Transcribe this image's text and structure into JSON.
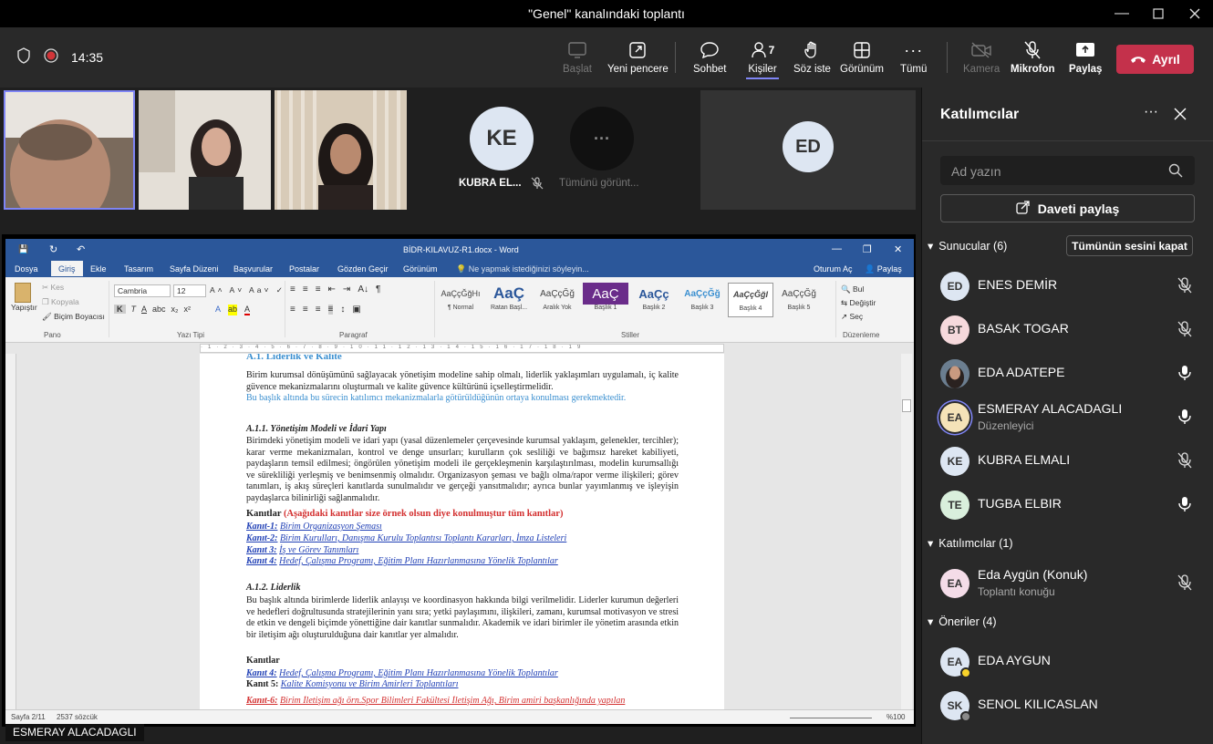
{
  "window": {
    "title": "\"Genel\" kanalındaki toplantı"
  },
  "toolbar": {
    "timer": "14:35",
    "start_label": "Başlat",
    "new_window_label": "Yeni pencere",
    "chat_label": "Sohbet",
    "people_label": "Kişiler",
    "people_count": "7",
    "raise_hand_label": "Söz iste",
    "view_label": "Görünüm",
    "more_label": "Tümü",
    "camera_label": "Kamera",
    "mic_label": "Mikrofon",
    "share_label": "Paylaş",
    "leave_label": "Ayrıl"
  },
  "stage": {
    "tile_ke_initials": "KE",
    "tile_ke_name": "KUBRA EL...",
    "view_all_label": "Tümünü görünt...",
    "tile_ed_initials": "ED",
    "presenter_name": "ESMERAY ALACADAGLI"
  },
  "word": {
    "doc_title": "BİDR-KILAVUZ-R1.docx - Word",
    "tabs": [
      "Dosya",
      "Giriş",
      "Ekle",
      "Tasarım",
      "Sayfa Düzeni",
      "Başvurular",
      "Postalar",
      "Gözden Geçir",
      "Görünüm"
    ],
    "tell_me": "Ne yapmak istediğinizi söyleyin...",
    "signin": "Oturum Aç",
    "share": "Paylaş",
    "clipboard": {
      "paste": "Yapıştır",
      "cut": "Kes",
      "copy": "Kopyala",
      "format_painter": "Biçim Boyacısı",
      "group": "Pano"
    },
    "font": {
      "name": "Cambria",
      "size": "12",
      "group": "Yazı Tipi"
    },
    "paragraph_group": "Paragraf",
    "styles": [
      {
        "preview": "AaÇçĞğHı",
        "name": "¶ Normal"
      },
      {
        "preview": "AaÇ",
        "name": "Ratan Başl..."
      },
      {
        "preview": "AaÇçĞğ",
        "name": "Aralık Yok"
      },
      {
        "preview": "AaÇ",
        "name": "Başlık 1"
      },
      {
        "preview": "AaÇç",
        "name": "Başlık 2"
      },
      {
        "preview": "AaÇçĞğ",
        "name": "Başlık 3"
      },
      {
        "preview": "AaÇçĞğI",
        "name": "Başlık 4"
      },
      {
        "preview": "AaÇçĞğ",
        "name": "Başlık 5"
      }
    ],
    "styles_group": "Stiller",
    "editing": {
      "find": "Bul",
      "replace": "Değiştir",
      "select": "Seç",
      "group": "Düzenleme"
    },
    "status_page": "Sayfa 2/11",
    "status_words": "2537 sözcük",
    "zoom": "%100",
    "doc": {
      "heading_partial": "A.1. Liderlik ve Kalite",
      "intro": "Birim kurumsal dönüşümünü sağlayacak yönetişim modeline sahip olmalı, liderlik yaklaşımları uygulamalı, iç kalite güvence mekanizmalarını oluşturmalı ve kalite güvence kültürünü içselleştirmelidir.",
      "intro_blue": "Bu başlık altında bu sürecin katılımcı mekanizmalarla götürüldüğünün ortaya konulması gerekmektedir.",
      "h_a11": "A.1.1. Yönetişim Modeli ve İdari Yapı",
      "a11_text": "Birimdeki yönetişim modeli ve idari yapı (yasal düzenlemeler çerçevesinde kurumsal yaklaşım, gelenekler, tercihler); karar verme mekanizmaları, kontrol ve denge unsurları; kurulların çok sesliliği ve bağımsız hareket kabiliyeti, paydaşların temsil edilmesi; öngörülen yönetişim modeli ile gerçekleşmenin karşılaştırılması, modelin kurumsallığı ve sürekliliği yerleşmiş ve benimsenmiş olmalıdır. Organizasyon şeması ve bağlı olma/rapor verme ilişkileri; görev tanımları, iş akış süreçleri kanıtlarda sunulmalıdır ve gerçeği yansıtmalıdır; ayrıca bunlar yayımlanmış ve işleyişin paydaşlarca bilinirliği sağlanmalıdır.",
      "kanitlar": "Kanıtlar",
      "kanitlar_note": "(Aşağıdaki kanıtlar size örnek olsun diye konulmuştur tüm kanıtlar)",
      "k1_label": "Kanıt-1:",
      "k1": "Birim Organizasyon Şeması",
      "k2_label": "Kanıt-2:",
      "k2": "Birim Kurulları, Danışma Kurulu Toplantısı Toplantı Kararları, İmza Listeleri",
      "k3_label": "Kanıt 3:",
      "k3": "İş ve Görev Tanımları",
      "k4_label": "Kanıt 4:",
      "k4": "Hedef, Çalışma Programı, Eğitim Planı Hazırlanmasına Yönelik Toplantılar",
      "h_a12": "A.1.2. Liderlik",
      "a12_text": "Bu başlık altında birimlerde liderlik anlayışı ve koordinasyon hakkında bilgi verilmelidir. Liderler kurumun değerleri ve hedefleri doğrultusunda stratejilerinin yanı sıra; yetki paylaşımını, ilişkileri, zamanı, kurumsal motivasyon ve stresi de etkin ve dengeli biçimde yönettiğine dair kanıtlar sunmalıdır. Akademik ve idari birimler ile yönetim arasında etkin bir iletişim ağı oluşturulduğuna dair kanıtlar yer almalıdır.",
      "kanitlar2": "Kanıtlar",
      "k4b_label": "Kanıt 4:",
      "k4b": "Hedef, Çalışma Programı, Eğitim Planı Hazırlanmasına Yönelik Toplantılar",
      "k5_label": "Kanıt 5:",
      "k5": "Kalite Komisyonu ve Birim Amirleri Toplantıları",
      "k6_label": "Kanıt-6:",
      "k6": "Birim İletişim ağı örn.Spor Bilimleri Fakültesi İletişim Ağı, Birim amiri başkanlığında yapılan"
    }
  },
  "panel": {
    "title": "Katılımcılar",
    "search_placeholder": "Ad yazın",
    "invite_label": "Daveti paylaş",
    "presenters_header": "Sunucular (6)",
    "mute_all_label": "Tümünün sesini kapat",
    "presenters": [
      {
        "initials": "ED",
        "name": "ENES DEMİR",
        "sub": "",
        "color": "#dde6f2",
        "mic": "off"
      },
      {
        "initials": "BT",
        "name": "BASAK TOGAR",
        "sub": "",
        "color": "#f6d9dc",
        "mic": "off"
      },
      {
        "initials": "",
        "name": "EDA ADATEPE",
        "sub": "",
        "color": "#5a5a5a",
        "mic": "on"
      },
      {
        "initials": "EA",
        "name": "ESMERAY ALACADAGLI",
        "sub": "Düzenleyici",
        "color": "#f5e3b8",
        "mic": "on"
      },
      {
        "initials": "KE",
        "name": "KUBRA ELMALI",
        "sub": "",
        "color": "#dde6f2",
        "mic": "off"
      },
      {
        "initials": "TE",
        "name": "TUGBA ELBIR",
        "sub": "",
        "color": "#d9efdc",
        "mic": "on"
      }
    ],
    "attendees_header": "Katılımcılar (1)",
    "attendees": [
      {
        "initials": "EA",
        "name": "Eda Aygün (Konuk)",
        "sub": "Toplantı konuğu",
        "color": "#f4dce8",
        "mic": "off"
      }
    ],
    "suggestions_header": "Öneriler (4)",
    "suggestions": [
      {
        "initials": "EA",
        "name": "EDA AYGUN",
        "color": "#dde6f2"
      },
      {
        "initials": "SK",
        "name": "SENOL KILICASLAN",
        "color": "#dde6f2"
      }
    ]
  },
  "colors": {
    "accent": "#6264a7",
    "leave": "#c4314b",
    "word": "#2b579a"
  }
}
